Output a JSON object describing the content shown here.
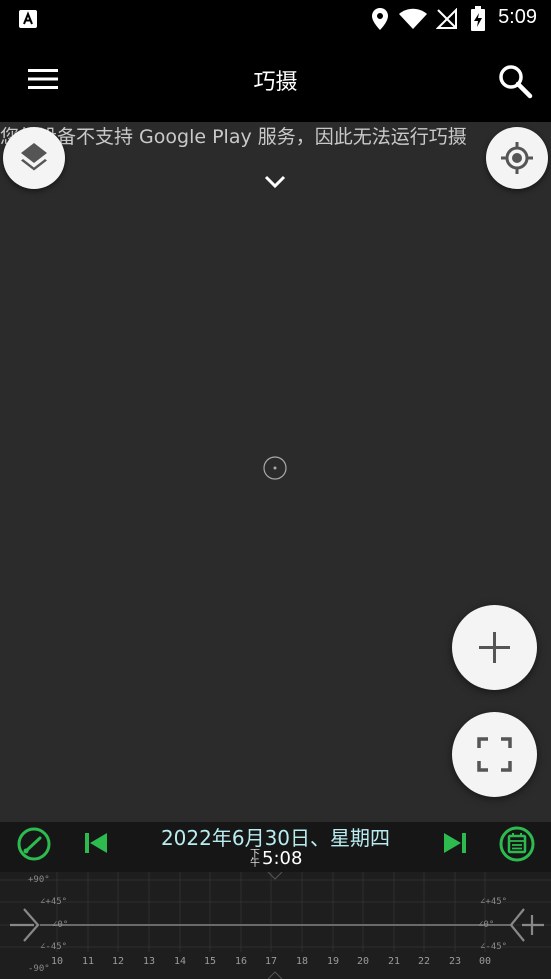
{
  "status_bar": {
    "time": "5:09",
    "icons": [
      "app-notification-icon",
      "location-icon",
      "wifi-icon",
      "no-signal-icon",
      "battery-charging-icon"
    ]
  },
  "app_bar": {
    "title": "巧摄",
    "menu_icon": "hamburger-menu-icon",
    "search_icon": "search-icon"
  },
  "map": {
    "notice": "您的设备不支持 Google Play 服务，因此无法运行巧摄",
    "layers_icon": "layers-icon",
    "locate_icon": "my-location-icon",
    "expand_icon": "chevron-down-icon",
    "zoom_in_icon": "plus-icon",
    "fullscreen_icon": "fullscreen-icon"
  },
  "control_bar": {
    "date": "2022年6月30日、星期四",
    "time_prefix": "下午",
    "time": "5:08",
    "accent_color": "#2dbb4f"
  },
  "timeline": {
    "hours": [
      "10",
      "11",
      "12",
      "13",
      "14",
      "15",
      "16",
      "17",
      "18",
      "19",
      "20",
      "21",
      "22",
      "23",
      "00"
    ],
    "degree_labels_left": [
      "+90°",
      "∠+45°",
      "∠0°",
      "∠-45°",
      "-90°"
    ],
    "degree_labels_right": [
      "∠+45°",
      "∠0°",
      "∠-45°"
    ]
  }
}
